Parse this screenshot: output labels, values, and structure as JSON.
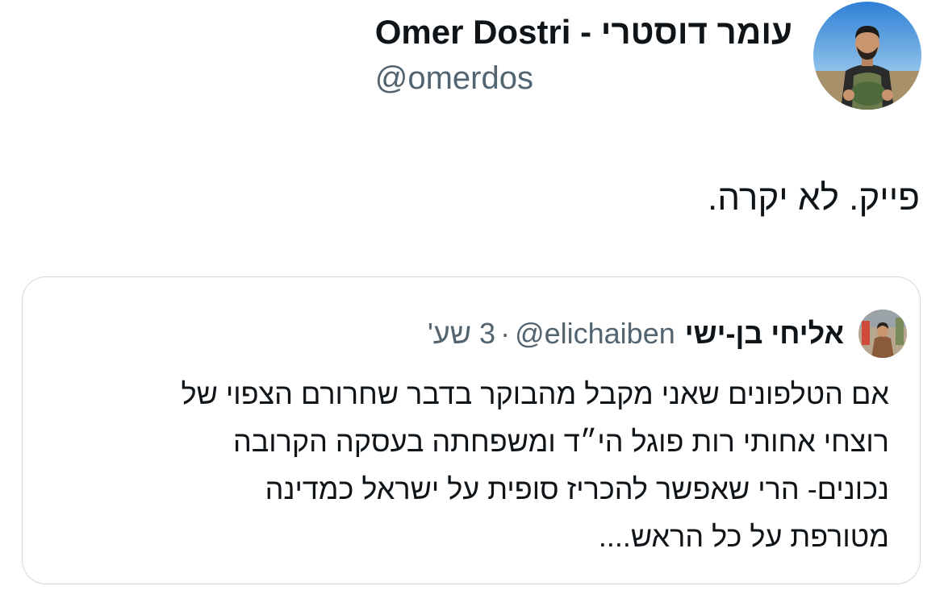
{
  "author": {
    "display_name": "עומר דוסטרי - Omer Dostri",
    "handle": "@omerdos",
    "avatar": "profile-photo"
  },
  "tweet": {
    "text": "פייק. לא יקרה."
  },
  "quoted_tweet": {
    "display_name": "אליחי בן-ישי",
    "handle": "@elichaiben",
    "separator": "·",
    "time": "3 שע'",
    "avatar": "profile-photo",
    "lines": [
      "אם הטלפונים שאני מקבל מהבוקר בדבר שחרורם הצפוי של",
      "רוצחי אחותי רות פוגל הי״ד ומשפחתה בעסקה הקרובה",
      "נכונים- הרי שאפשר להכריז סופית על ישראל כמדינה",
      "מטורפת על כל הראש...."
    ]
  },
  "colors": {
    "text": "#0f1419",
    "secondary": "#536471",
    "border": "#cfd9de"
  }
}
